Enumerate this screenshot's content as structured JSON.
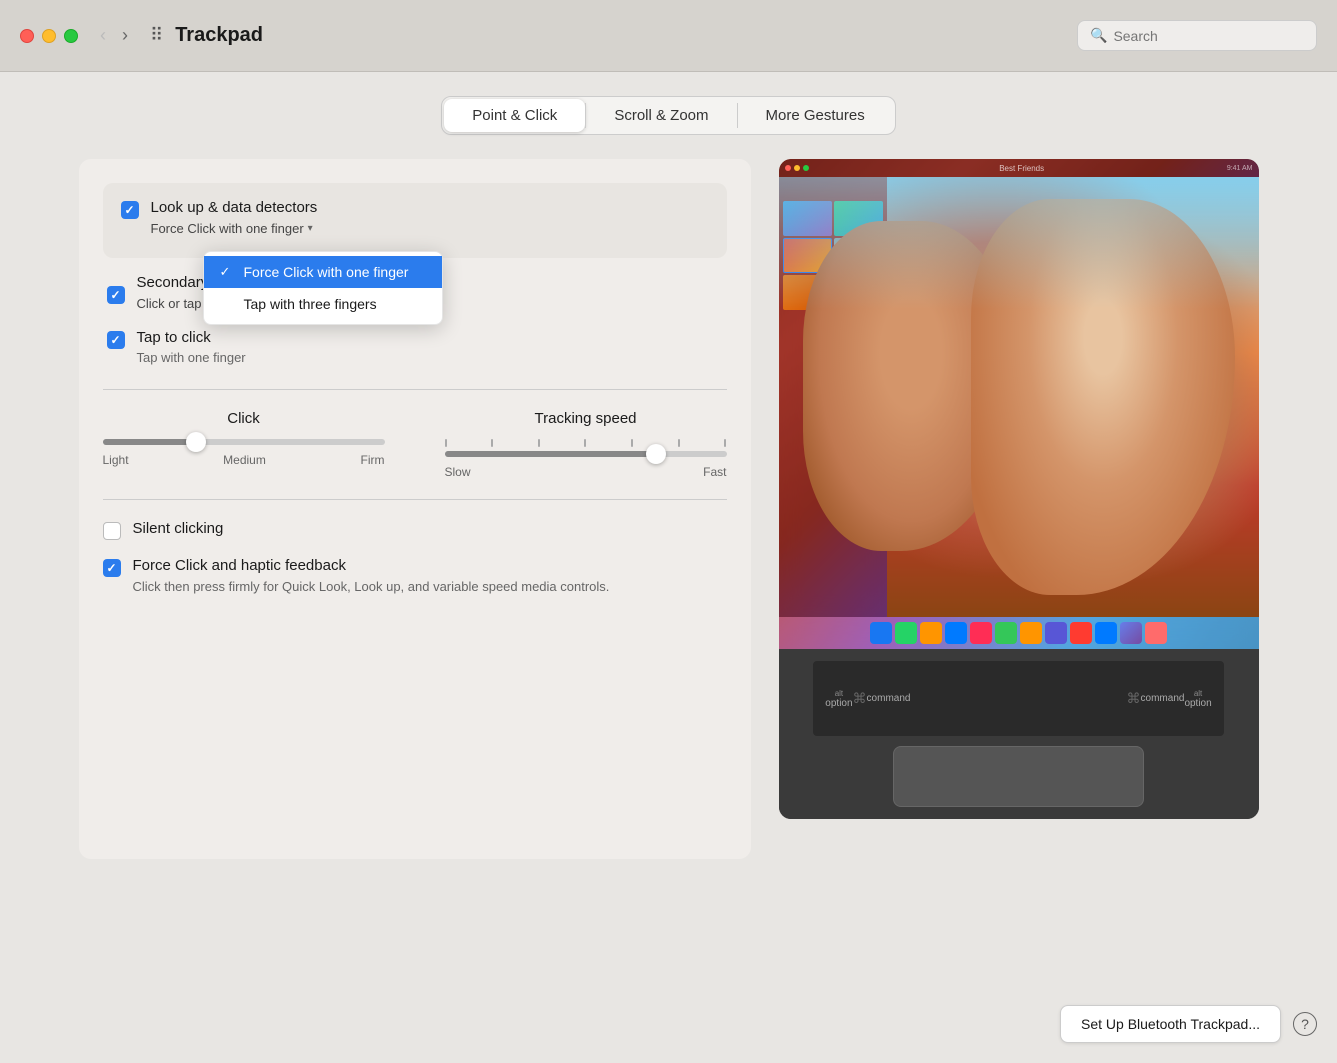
{
  "titlebar": {
    "title": "Trackpad",
    "search_placeholder": "Search",
    "back_btn": "‹",
    "forward_btn": "›",
    "grid_icon": "⠿"
  },
  "tabs": [
    {
      "id": "point-click",
      "label": "Point & Click",
      "active": true
    },
    {
      "id": "scroll-zoom",
      "label": "Scroll & Zoom",
      "active": false
    },
    {
      "id": "more-gestures",
      "label": "More Gestures",
      "active": false
    }
  ],
  "settings": {
    "look_up": {
      "label": "Look up & data detectors",
      "checked": true,
      "dropdown": {
        "current_value": "Force Click with one finger",
        "options": [
          {
            "label": "Force Click with one finger",
            "selected": true
          },
          {
            "label": "Tap with three fingers",
            "selected": false
          }
        ]
      }
    },
    "secondary_click": {
      "label": "Secondary click",
      "checked": true
    },
    "tap_to_click": {
      "label": "Tap to click",
      "sublabel": "Tap with one finger",
      "checked": true
    }
  },
  "sliders": {
    "click": {
      "title": "Click",
      "labels": [
        "Light",
        "Medium",
        "Firm"
      ],
      "value": 33
    },
    "tracking": {
      "title": "Tracking speed",
      "labels": [
        "Slow",
        "",
        "Fast"
      ],
      "value": 75
    }
  },
  "bottom_settings": {
    "silent_clicking": {
      "label": "Silent clicking",
      "checked": false
    },
    "force_click_haptic": {
      "label": "Force Click and haptic feedback",
      "description": "Click then press firmly for Quick Look, Look up, and variable speed media controls.",
      "checked": true
    }
  },
  "dropdown_menu": {
    "option1": "Force Click with one finger",
    "option2": "Tap with three fingers"
  },
  "footer": {
    "setup_btn": "Set Up Bluetooth Trackpad...",
    "help_btn": "?"
  }
}
